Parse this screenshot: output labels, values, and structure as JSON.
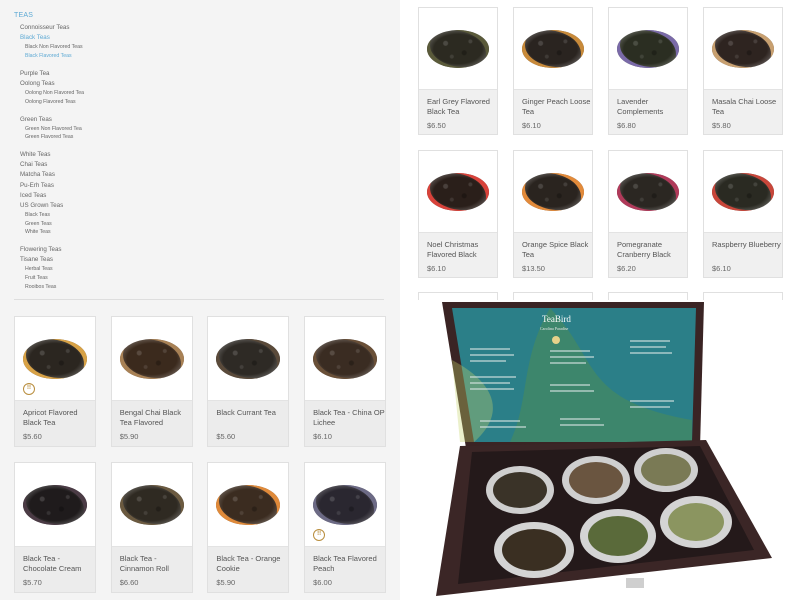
{
  "sidebar": {
    "heading": "TEAS",
    "items": [
      {
        "label": "Connoisseur Teas",
        "level": 1,
        "active": false
      },
      {
        "label": "Black Teas",
        "level": 1,
        "active": true
      },
      {
        "label": "Black Non Flavored Teas",
        "level": 2,
        "active": false
      },
      {
        "label": "Black Flavored Teas",
        "level": 2,
        "active": true
      },
      {
        "label": "Purple Tea",
        "level": 1,
        "active": false
      },
      {
        "label": "Oolong Teas",
        "level": 1,
        "active": false
      },
      {
        "label": "Oolong Non Flavored Tea",
        "level": 2,
        "active": false
      },
      {
        "label": "Oolong Flavored Teas",
        "level": 2,
        "active": false
      },
      {
        "label": "Green Teas",
        "level": 1,
        "active": false
      },
      {
        "label": "Green Non Flavored Tea",
        "level": 2,
        "active": false
      },
      {
        "label": "Green Flavored Teas",
        "level": 2,
        "active": false
      },
      {
        "label": "White Teas",
        "level": 1,
        "active": false
      },
      {
        "label": "Chai Teas",
        "level": 1,
        "active": false
      },
      {
        "label": "Matcha Teas",
        "level": 1,
        "active": false
      },
      {
        "label": "Pu-Erh Teas",
        "level": 1,
        "active": false
      },
      {
        "label": "Iced Teas",
        "level": 1,
        "active": false
      },
      {
        "label": "US Grown Teas",
        "level": 1,
        "active": false
      },
      {
        "label": "Black Teas",
        "level": 2,
        "active": false
      },
      {
        "label": "Green Teas",
        "level": 2,
        "active": false
      },
      {
        "label": "White Teas",
        "level": 2,
        "active": false
      },
      {
        "label": "Flowering Teas",
        "level": 1,
        "active": false
      },
      {
        "label": "Tisane Teas",
        "level": 1,
        "active": false
      },
      {
        "label": "Herbal Teas",
        "level": 2,
        "active": false
      },
      {
        "label": "Fruit Teas",
        "level": 2,
        "active": false
      },
      {
        "label": "Rooibos Teas",
        "level": 2,
        "active": false
      }
    ]
  },
  "products_left": [
    {
      "name": "Apricot Flavored Black Tea",
      "price": "$5.60",
      "badge": "!!",
      "color": "#2b2620",
      "accent": "#d8a246"
    },
    {
      "name": "Bengal Chai Black Tea Flavored",
      "price": "$5.90",
      "badge": "",
      "color": "#3b2a1d",
      "accent": "#a88155"
    },
    {
      "name": "Black Currant Tea",
      "price": "$5.60",
      "badge": "",
      "color": "#2e2a25",
      "accent": "#5a4a3a"
    },
    {
      "name": "Black Tea - China OP Lichee",
      "price": "$6.10",
      "badge": "",
      "color": "#3a2c22",
      "accent": "#6a5038"
    },
    {
      "name": "Black Tea - Chocolate Cream",
      "price": "$5.70",
      "badge": "",
      "color": "#1f1b1c",
      "accent": "#4b3b45"
    },
    {
      "name": "Black Tea - Cinnamon Roll",
      "price": "$6.60",
      "badge": "",
      "color": "#2f2a22",
      "accent": "#6b5a40"
    },
    {
      "name": "Black Tea - Orange Cookie",
      "price": "$5.90",
      "badge": "",
      "color": "#3b2c20",
      "accent": "#e08a3a"
    },
    {
      "name": "Black Tea Flavored Peach",
      "price": "$6.00",
      "badge": "!!",
      "color": "#2a2730",
      "accent": "#6c6a85"
    }
  ],
  "products_right": [
    {
      "name": "Earl Grey Flavored Black Tea",
      "price": "$6.50",
      "color": "#2c2a21",
      "accent": "#5a5a3a"
    },
    {
      "name": "Ginger Peach Loose Tea",
      "price": "$6.10",
      "color": "#2a2420",
      "accent": "#c88a3a"
    },
    {
      "name": "Lavender Complements",
      "price": "$6.80",
      "color": "#2b2e22",
      "accent": "#7a6aa8"
    },
    {
      "name": "Masala Chai Loose Tea",
      "price": "$5.80",
      "color": "#2e2420",
      "accent": "#c8a070"
    },
    {
      "name": "Noel Christmas Flavored Black",
      "price": "$6.10",
      "color": "#2a1f1a",
      "accent": "#d8423a"
    },
    {
      "name": "Orange Spice Black Tea",
      "price": "$13.50",
      "color": "#2a241f",
      "accent": "#e28a3a"
    },
    {
      "name": "Pomegranate Cranberry Black",
      "price": "$6.20",
      "color": "#2b2722",
      "accent": "#b03a5a"
    },
    {
      "name": "Raspberry Blueberry",
      "price": "$6.10",
      "color": "#2a2a22",
      "accent": "#c8463a"
    }
  ],
  "gift_box": {
    "brand": "TeaBird",
    "tagline": "Carolina Paradise",
    "box_color": "#3a2a2a",
    "panel_color": "#2e6f7a",
    "tin_color": "#c9c9c9"
  }
}
